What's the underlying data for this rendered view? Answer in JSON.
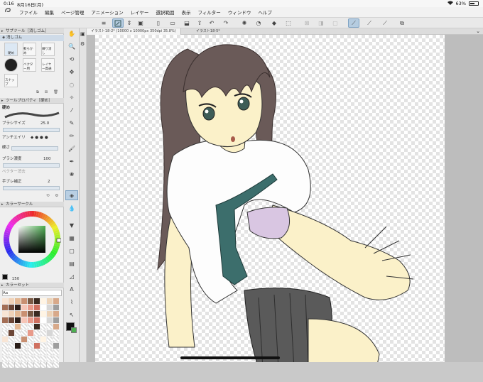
{
  "status": {
    "time": "0:16",
    "date": "8月16日(月)",
    "battery_pct": "63%",
    "battery_level": 0.63
  },
  "menu": {
    "items": [
      "ファイル",
      "編集",
      "ページ管理",
      "アニメーション",
      "レイヤー",
      "選択範囲",
      "表示",
      "フィルター",
      "ウィンドウ",
      "ヘルプ"
    ]
  },
  "subtool": {
    "header": "サブツール［消しゴム］",
    "current": "消しゴム",
    "brushes": [
      "硬め",
      "軟らかめ",
      "練り消し",
      "ベクター用",
      "レイヤー貫通",
      "スナップ"
    ]
  },
  "toolprop": {
    "header": "ツールプロパティ［硬め］",
    "name": "硬め",
    "brush_size_label": "ブラシサイズ",
    "brush_size_value": "25.0",
    "antialias_label": "アンチエイリ",
    "hardness_label": "硬さ",
    "density_label": "ブラシ濃度",
    "density_value": "100",
    "vector_label": "ベクター消去",
    "stabilization_label": "手ブレ補正",
    "stabilization_value": "2"
  },
  "colorwheel": {
    "header": "カラーサークル",
    "value_field": "150"
  },
  "colorset": {
    "header": "カラーセット",
    "set_name": "Aa"
  },
  "document": {
    "active_tab": "イラスト18-2* (10000 x 10000px 350dpi 35.8%)",
    "other_tab": "イラスト18-5*"
  },
  "colors": {
    "main": "#111111",
    "sub": "#4caf50"
  }
}
